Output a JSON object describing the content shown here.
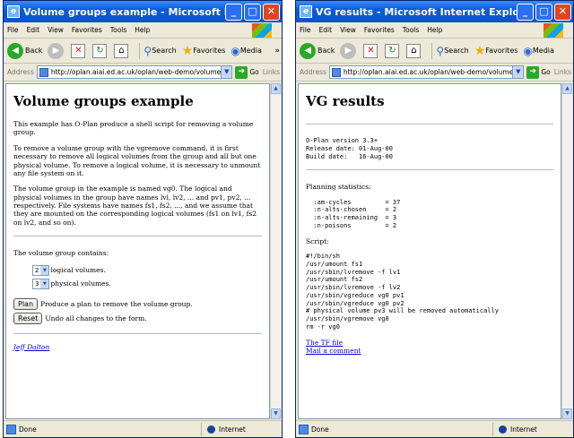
{
  "left_window": {
    "title": "Volume groups example - Microsoft Internet Explorer",
    "menu": [
      "File",
      "Edit",
      "View",
      "Favorites",
      "Tools",
      "Help"
    ],
    "toolbar": {
      "back": "Back",
      "search": "Search",
      "favorites": "Favorites",
      "media": "Media"
    },
    "address_label": "Address",
    "url": "http://oplan.aiai.ed.ac.uk/oplan/web-demo/volume-groups.",
    "go_label": "Go",
    "links_label": "Links",
    "status": {
      "text": "Done",
      "zone": "Internet"
    },
    "page": {
      "heading": "Volume groups example",
      "p1": "This example has O-Plan produce a shell script for removing a volume group.",
      "p2": "To remove a volume group with the vgremove command, it is first necessary to remove all logical volumes from the group and all but one physical volume. To remove a logical volume, it is necessary to unmount any file system on it.",
      "p3": "The volume group in the example is named vg0. The logical and physical volumes in the group have names lvl, lv2, ... and pv1, pv2, ... respectively. File systems have names fs1, fs2, ..., and we assume that they are mounted on the corresponding logical volumes (fs1 on lv1, fs2 on lv2, and so on).",
      "contains_label": "The volume group contains:",
      "logical": {
        "value": "2",
        "label": "logical volumes."
      },
      "physical": {
        "value": "3",
        "label": "physical volumes."
      },
      "plan_button": "Plan",
      "plan_text": "Produce a plan to remove the volume group.",
      "reset_button": "Reset",
      "reset_text": "Undo all changes to the form.",
      "author_link": "Jeff Dalton"
    }
  },
  "right_window": {
    "title": "VG results - Microsoft Internet Explorer",
    "menu": [
      "File",
      "Edit",
      "View",
      "Favorites",
      "Tools",
      "Help"
    ],
    "toolbar": {
      "back": "Back",
      "search": "Search",
      "favorites": "Favorites",
      "media": "Media"
    },
    "address_label": "Address",
    "url": "http://oplan.aiai.ed.ac.uk/oplan/web-demo/volume-groups.",
    "go_label": "Go",
    "links_label": "Links",
    "status": {
      "text": "Done",
      "zone": "Internet"
    },
    "page": {
      "heading": "VG results",
      "version_block": "O-Plan version 3.3+\nRelease date: 01-Aug-00\nBuild date:   16-Aug-00",
      "stats_label": "Planning statistics:",
      "stats_block": "  :am-cycles         = 37\n  :n-alts-chosen     = 2\n  :n-alts-remaining  = 3\n  :n-poisons         = 2",
      "script_label": "Script:",
      "script_block": "#!/bin/sh\n/usr/umount fs1\n/usr/sbin/lvremove -f lv1\n/usr/umount fs2\n/usr/sbin/lvremove -f lv2\n/usr/sbin/vgreduce vg0 pv1\n/usr/sbin/vgreduce vg0 pv2\n# physical volume pv3 will be removed automatically\n/usr/sbin/vgremove vg0\nrm -r vg0",
      "tf_link": "The TF file",
      "mail_link": "Mail a comment"
    }
  }
}
